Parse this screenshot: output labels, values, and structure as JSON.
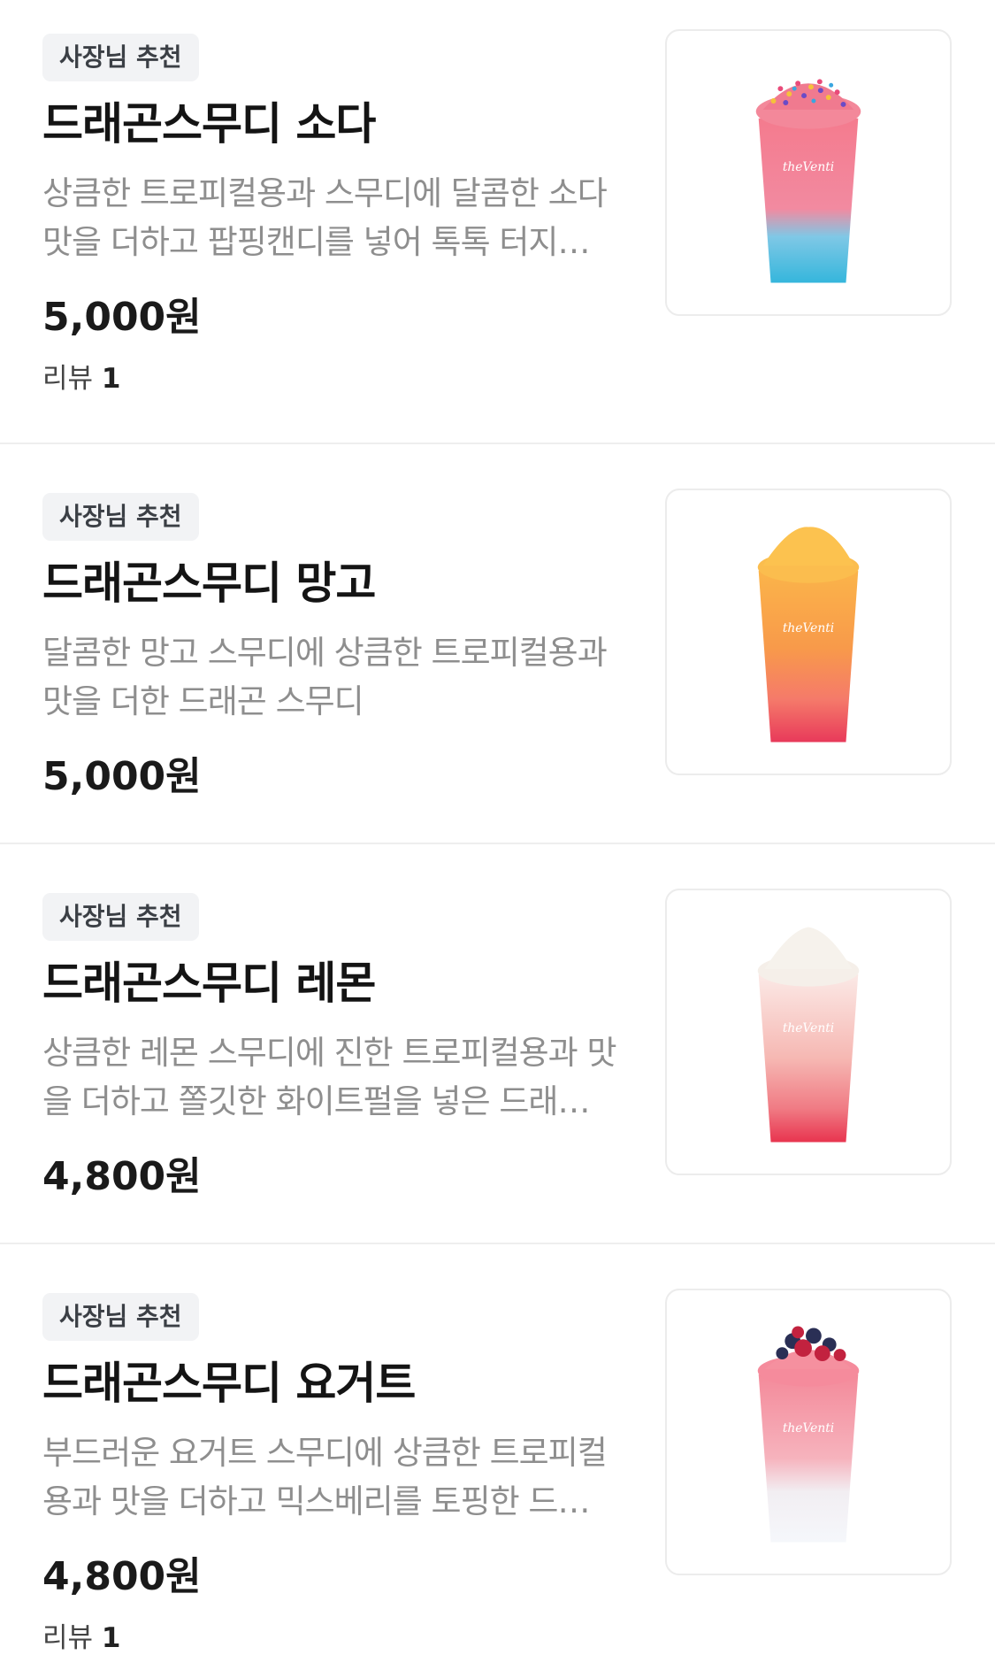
{
  "menu_items": [
    {
      "badge": "사장님 추천",
      "name": "드래곤스무디 소다",
      "description": "상큼한 트로피컬용과 스무디에 달콤한 소다맛을 더하고 팝핑캔디를 넣어 톡톡 터지는 드래곤 스무디",
      "price": "5,000원",
      "review_label": "리뷰",
      "review_count": "1",
      "image_icon": "smoothie-soda-image",
      "brand_text": "theVenti"
    },
    {
      "badge": "사장님 추천",
      "name": "드래곤스무디 망고",
      "description": "달콤한 망고 스무디에 상큼한 트로피컬용과 맛을 더한 드래곤 스무디",
      "price": "5,000원",
      "image_icon": "smoothie-mango-image",
      "brand_text": "theVenti"
    },
    {
      "badge": "사장님 추천",
      "name": "드래곤스무디 레몬",
      "description": "상큼한 레몬 스무디에 진한 트로피컬용과 맛을 더하고 쫄깃한 화이트펄을 넣은 드래곤 스무디",
      "price": "4,800원",
      "image_icon": "smoothie-lemon-image",
      "brand_text": "theVenti"
    },
    {
      "badge": "사장님 추천",
      "name": "드래곤스무디 요거트",
      "description": "부드러운 요거트 스무디에 상큼한 트로피컬용과 맛을 더하고 믹스베리를 토핑한 드래곤 스무디",
      "price": "4,800원",
      "review_label": "리뷰",
      "review_count": "1",
      "image_icon": "smoothie-yogurt-image",
      "brand_text": "theVenti"
    }
  ]
}
